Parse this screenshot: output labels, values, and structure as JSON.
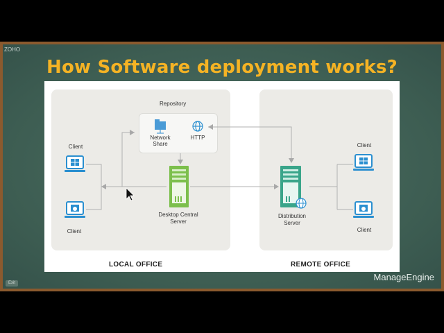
{
  "top_label": "ZOHO",
  "exit_label": "Exit",
  "title": "How Software deployment works?",
  "diagram": {
    "repository_label": "Repository",
    "network_share_label": "Network\nShare",
    "http_label": "HTTP",
    "central_server_label": "Desktop Central\nServer",
    "distribution_server_label": "Distribution\nServer",
    "client_label": "Client",
    "local_office_label": "LOCAL OFFICE",
    "remote_office_label": "REMOTE OFFICE"
  },
  "brand": "ManageEngine",
  "colors": {
    "title": "#f5b324",
    "board": "#3d5d52",
    "frame": "#8b5a2e",
    "server_green": "#7cbf4c",
    "server_teal": "#3aa58a",
    "client_blue": "#2a8fd0",
    "wire": "#aaaaaa"
  }
}
